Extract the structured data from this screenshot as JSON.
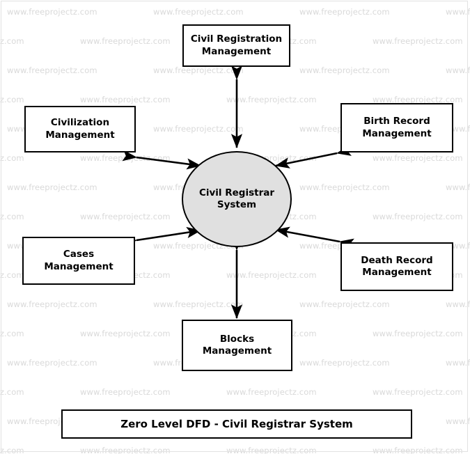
{
  "diagram": {
    "title": "Zero Level DFD - Civil Registrar System",
    "process": {
      "name": "Civil Registrar System",
      "line1": "Civil Registrar",
      "line2": "System",
      "fill": "#e0e0e0",
      "stroke": "#000000"
    },
    "entities": [
      {
        "id": "civil-registration-management",
        "line1": "Civil Registration",
        "line2": "Management",
        "position": "top"
      },
      {
        "id": "civilization-management",
        "line1": "Civilization",
        "line2": "Management",
        "position": "top-left"
      },
      {
        "id": "birth-record-management",
        "line1": "Birth Record",
        "line2": "Management",
        "position": "top-right"
      },
      {
        "id": "cases-management",
        "line1": "Cases",
        "line2": "Management",
        "position": "bottom-left"
      },
      {
        "id": "death-record-management",
        "line1": "Death Record",
        "line2": "Management",
        "position": "bottom-right"
      },
      {
        "id": "blocks-management",
        "line1": "Blocks",
        "line2": "Management",
        "position": "bottom"
      }
    ],
    "flows": [
      {
        "from": "Civil Registration Management",
        "to": "Civil Registrar System",
        "direction": "bidirectional"
      },
      {
        "from": "Civilization Management",
        "to": "Civil Registrar System",
        "direction": "bidirectional"
      },
      {
        "from": "Birth Record Management",
        "to": "Civil Registrar System",
        "direction": "bidirectional"
      },
      {
        "from": "Cases Management",
        "to": "Civil Registrar System",
        "direction": "bidirectional"
      },
      {
        "from": "Death Record Management",
        "to": "Civil Registrar System",
        "direction": "bidirectional"
      },
      {
        "from": "Blocks Management",
        "to": "Civil Registrar System",
        "direction": "bidirectional"
      }
    ]
  },
  "watermark": {
    "text": "www.freeprojectz.com",
    "color": "#d9d9d9"
  }
}
